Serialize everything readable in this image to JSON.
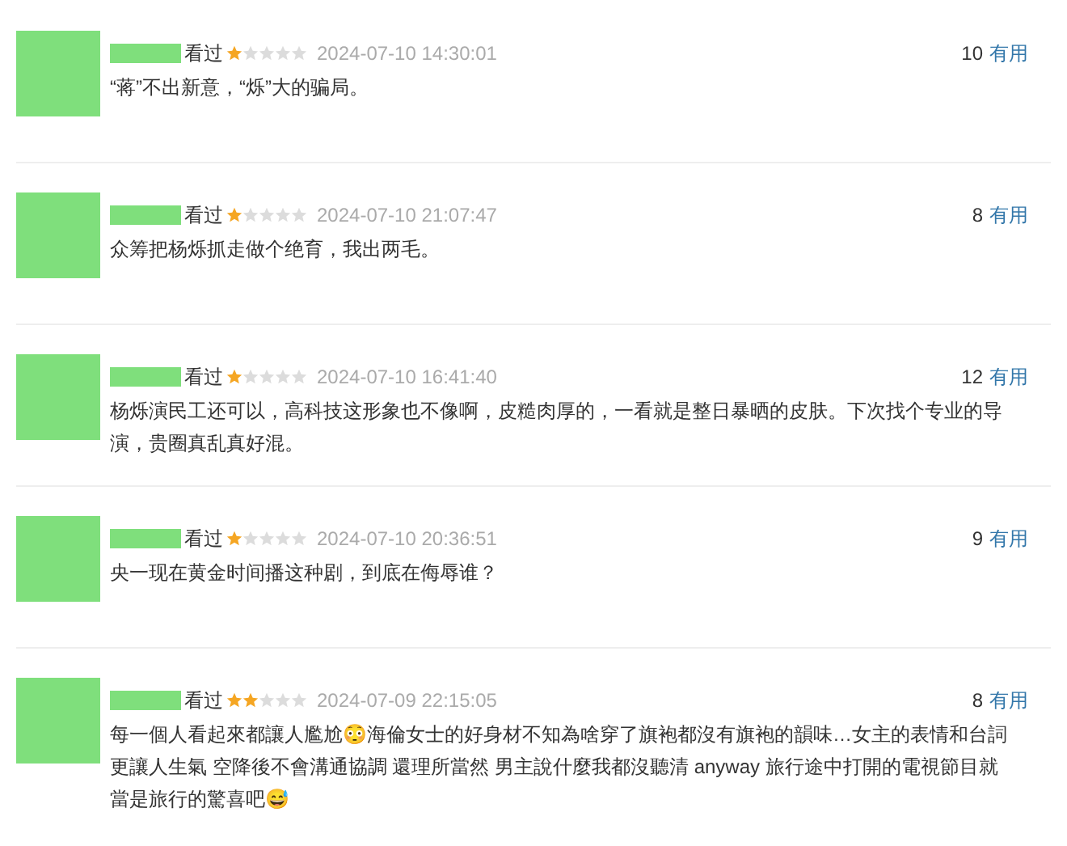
{
  "comments": [
    {
      "status": "看过",
      "stars": 1,
      "time": "2024-07-10 14:30:01",
      "votes": "10",
      "vote_label": "有用",
      "content": "“蒋”不出新意，“烁”大的骗局。"
    },
    {
      "status": "看过",
      "stars": 1,
      "time": "2024-07-10 21:07:47",
      "votes": "8",
      "vote_label": "有用",
      "content": "众筹把杨烁抓走做个绝育，我出两毛。"
    },
    {
      "status": "看过",
      "stars": 1,
      "time": "2024-07-10 16:41:40",
      "votes": "12",
      "vote_label": "有用",
      "content": "杨烁演民工还可以，高科技这形象也不像啊，皮糙肉厚的，一看就是整日暴晒的皮肤。下次找个专业的导演，贵圈真乱真好混。"
    },
    {
      "status": "看过",
      "stars": 1,
      "time": "2024-07-10 20:36:51",
      "votes": "9",
      "vote_label": "有用",
      "content": "央一现在黄金时间播这种剧，到底在侮辱谁？"
    },
    {
      "status": "看过",
      "stars": 2,
      "time": "2024-07-09 22:15:05",
      "votes": "8",
      "vote_label": "有用",
      "content": "每一個人看起來都讓人尷尬😳海倫女士的好身材不知為啥穿了旗袍都沒有旗袍的韻味…女主的表情和台詞更讓人生氣 空降後不會溝通協調 還理所當然 男主說什麼我都沒聽清 anyway 旅行途中打開的電視節目就當是旅行的驚喜吧😅"
    }
  ]
}
